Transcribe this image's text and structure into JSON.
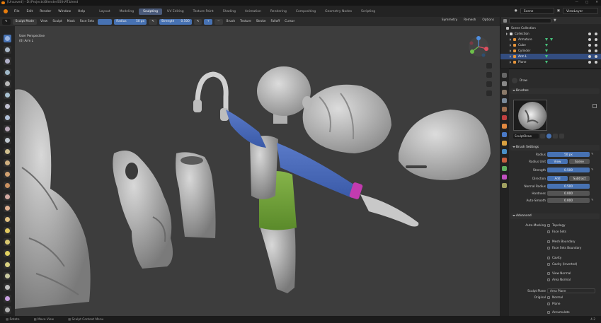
{
  "title_bar": {
    "text": "[Unsaved] - D:\\Projects\\BlenderSS\\HAT.blend"
  },
  "menu": {
    "items": [
      "File",
      "Edit",
      "Render",
      "Window",
      "Help"
    ]
  },
  "workspaces": {
    "tabs": [
      "Layout",
      "Modeling",
      "Sculpting",
      "UV Editing",
      "Texture Paint",
      "Shading",
      "Animation",
      "Rendering",
      "Compositing",
      "Geometry Nodes",
      "Scripting"
    ],
    "active": "Sculpting"
  },
  "scene": {
    "label": "Scene",
    "view_layer": "ViewLayer"
  },
  "tool_header": {
    "mode": "Sculpt Mode",
    "view": "View",
    "sculpt": "Sculpt",
    "mask": "Mask",
    "face_sets": "Face Sets",
    "radius_label": "Radius",
    "radius_value": "50 px",
    "strength_label": "Strength",
    "strength_value": "0.500",
    "brush": "Brush",
    "texture": "Texture",
    "stroke": "Stroke",
    "falloff": "Falloff",
    "cursor": "Cursor",
    "symmetry": "Symmetry",
    "remesh": "Remesh",
    "options": "Options"
  },
  "viewport": {
    "perspective": "User Perspective",
    "object": "(0) Arm L"
  },
  "outliner": {
    "title": "Scene Collection",
    "rows": [
      {
        "name": "Collection",
        "level": 0,
        "selected": false
      },
      {
        "name": "Armature",
        "level": 1,
        "selected": false
      },
      {
        "name": "Cube",
        "level": 1,
        "selected": false
      },
      {
        "name": "Cylinder",
        "level": 1,
        "selected": false
      },
      {
        "name": "Arm L",
        "level": 1,
        "selected": true
      },
      {
        "name": "Plane",
        "level": 1,
        "selected": false
      }
    ]
  },
  "properties": {
    "tool_name": "Draw",
    "brushes_header": "Brushes",
    "brush_name": "SculptDraw",
    "brush_settings_header": "Brush Settings",
    "radius_label": "Radius",
    "radius_value": "50 px",
    "radius_unit_label": "Radius Unit",
    "radius_unit_view": "View",
    "radius_unit_scene": "Scene",
    "strength_label": "Strength",
    "strength_value": "0.500",
    "direction_label": "Direction",
    "direction_add": "Add",
    "direction_subtract": "Subtract",
    "normal_radius_label": "Normal Radius",
    "normal_radius_value": "0.500",
    "hardness_label": "Hardness",
    "hardness_value": "0.000",
    "autosmooth_label": "Auto-Smooth",
    "autosmooth_value": "0.000",
    "advanced_header": "Advanced",
    "automasking_label": "Auto-Masking",
    "checkboxes": [
      {
        "label": "Topology",
        "checked": false
      },
      {
        "label": "Face Sets",
        "checked": false
      },
      {
        "label": "Mesh Boundary",
        "checked": false
      },
      {
        "label": "Face Sets Boundary",
        "checked": false
      },
      {
        "label": "Cavity",
        "checked": false
      },
      {
        "label": "Cavity (Inverted)",
        "checked": false
      },
      {
        "label": "View Normal",
        "checked": false
      },
      {
        "label": "Area Normal",
        "checked": false
      }
    ],
    "sculpt_plane_label": "Sculpt Plane",
    "sculpt_plane_value": "Area Plane",
    "original_label": "Original",
    "original_normal": "Normal",
    "original_plane": "Plane",
    "accumulate": "Accumulate"
  },
  "status_bar": {
    "items": [
      "Rotate",
      "Move View",
      "Sculpt Context Menu"
    ],
    "version": "4.2"
  }
}
